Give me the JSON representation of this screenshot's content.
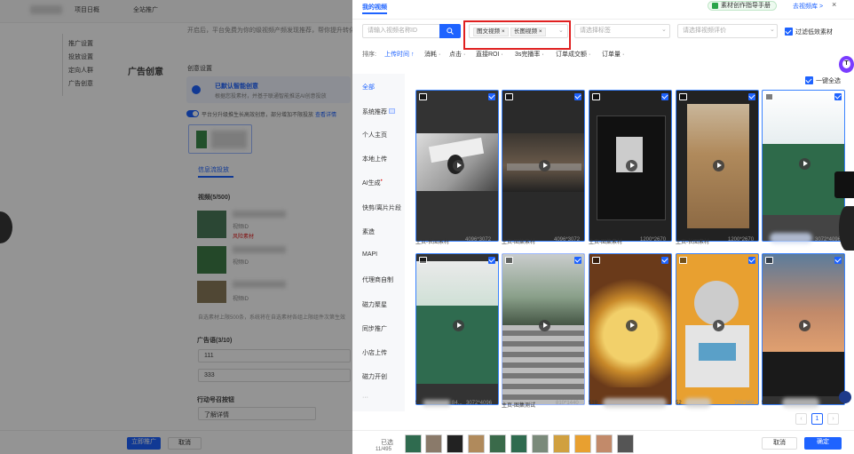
{
  "background": {
    "top_items": [
      "项目日概",
      "全站推广"
    ],
    "intro_text": "开启后，平台免费为你的级视频产频发现推荐，帮你提升转化效果",
    "left_menu": [
      "推广设置",
      "投放设置",
      "定向人群",
      "广告创意"
    ],
    "section_title": "广告创意",
    "creative_setting": "创意设置",
    "smart_creative": "已默认智能创意",
    "smart_desc": "根据您投素材，并基于联通智能推送AI创意投放",
    "toggle_label": "平台分升级推生长高效创意，部分增加不限投放",
    "toggle_link": "查看详情",
    "tab_label": "信息流投放",
    "video_count": "视频(5/500)",
    "video_label": "视频ID",
    "risk_badge": "风险素材",
    "notice": "自选素材上限500条，系统将在自选素材各组上限组件次第生效",
    "ad_lang_label": "广告语(3/10)",
    "ad_lang_values": [
      "111",
      "333"
    ],
    "cta_label": "行动号召按钮",
    "cta_value": "了解详情",
    "submit_btn": "立即推广",
    "cancel_btn": "取消"
  },
  "drawer": {
    "title": "我的视频",
    "guide_label": "素材创作指导手册",
    "douyin_link": "去视频库 >",
    "close": "×",
    "search_placeholder": "请输入视频名称ID",
    "tags": [
      "图文视频",
      "长图视频"
    ],
    "tag_close": "×",
    "label_placeholder": "请选择标签",
    "eval_placeholder": "请选择视频评价",
    "filter_low": "过滤低效素材",
    "sort": {
      "label": "排序:",
      "options": [
        "上传时间 ↑",
        "消耗 ·",
        "点击 ·",
        "直接ROI ·",
        "3s完播率 ·",
        "订单成交额 ·",
        "订单量 ·"
      ]
    },
    "select_all": "一键全选",
    "nav": [
      "全部",
      "系统推荐",
      "个人主页",
      "本地上传",
      "AI生成",
      "快剪/离片片段",
      "素造",
      "MAPI",
      "代理商自制",
      "磁力聚星",
      "同步推广",
      "小店上传",
      "磁力开创"
    ],
    "cards_row1": [
      {
        "caption": "主页-长图素材",
        "size": "4096*3072"
      },
      {
        "caption": "主页-图集素材",
        "size": "4096*3072"
      },
      {
        "caption": "主页-图集素材",
        "size": "1200*2670"
      },
      {
        "caption": "主页-长图素材",
        "size": "1200*2670"
      },
      {
        "caption": "",
        "size": "3072*4096"
      }
    ],
    "cards_row2": [
      {
        "caption": "51",
        "size": "3072*4096",
        "mid": "84..."
      },
      {
        "caption": "主页-图集测试",
        "size": "810*1440"
      },
      {
        "caption": "519",
        "size": ""
      },
      {
        "caption": "52",
        "size": "720*960"
      },
      {
        "caption": "52354",
        "size": ""
      }
    ],
    "page_current": "1",
    "selected_label": "已选",
    "selected_count": "11/495",
    "cancel_btn": "取消",
    "confirm_btn": "确定"
  },
  "colors": {
    "accent": "#1e63ff",
    "highlight_box": "#e02020",
    "risk": "#e02020"
  }
}
